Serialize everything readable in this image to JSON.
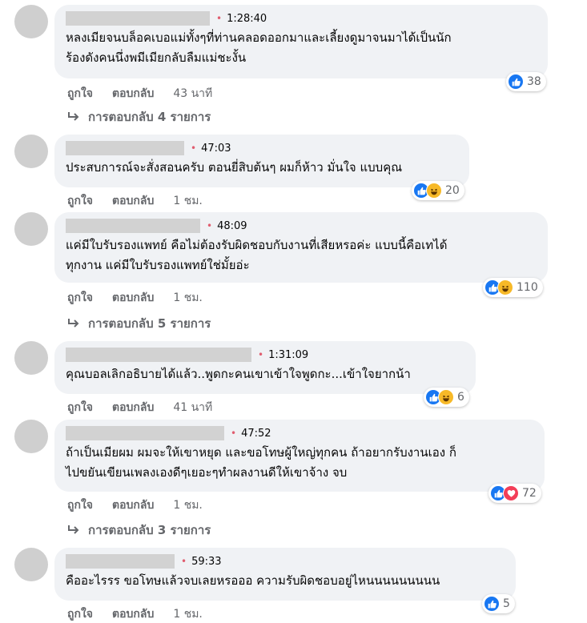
{
  "actions": {
    "like": "ถูกใจ",
    "reply": "ตอบกลับ"
  },
  "comments": [
    {
      "time": "1:28:40",
      "lines": [
        "หลงเมียจนบล็อคเบอแม่ทั้งๆที่ท่านคลอดออกมาและเลี้ยงดูมาจนมาได้เป็นนัก",
        "ร้องดังคนนึ่งพมีเมียกลับลืมแม่ชะงั้น"
      ],
      "ago": "43 นาที",
      "reactions": [
        "like"
      ],
      "count": "38",
      "replies": "การตอบกลับ 4 รายการ"
    },
    {
      "time": "47:03",
      "lines": [
        "ประสบการณ์จะสั่งสอนครับ ตอนยี่สิบต้นๆ ผมก็ห้าว มั่นใจ แบบคุณ"
      ],
      "ago": "1 ชม.",
      "reactions": [
        "like",
        "haha"
      ],
      "count": "20",
      "replies": ""
    },
    {
      "time": "48:09",
      "lines": [
        "แค่มีใบรับรองแพทย์ คือไม่ต้องรับผิดชอบกับงานที่เสียหรอค่ะ แบบนี้คือเทได้",
        "ทุกงาน แค่มีใบรับรองแพทย์ใช่มั้ยอ่ะ"
      ],
      "ago": "1 ชม.",
      "reactions": [
        "like",
        "haha"
      ],
      "count": "110",
      "replies": "การตอบกลับ 5 รายการ"
    },
    {
      "time": "1:31:09",
      "lines": [
        "คุณบอลเลิกอธิบายได้แล้ว..พูดกะคนเขาเข้าใจพูดกะ...เข้าใจยากน้า"
      ],
      "ago": "41 นาที",
      "reactions": [
        "like",
        "haha"
      ],
      "count": "6",
      "replies": ""
    },
    {
      "time": "47:52",
      "lines": [
        "ถ้าเป็นเมียผม ผมจะให้เขาหยุด และขอโทษผู้ใหญ่ทุกคน ถ้าอยากรับงานเอง ก็",
        "ไปขยันเขียนเพลงเองดีๆเยอะๆทำผลงานดีให้เขาจ้าง จบ"
      ],
      "ago": "1 ชม.",
      "reactions": [
        "like",
        "love"
      ],
      "count": "72",
      "replies": "การตอบกลับ 3 รายการ"
    },
    {
      "time": "59:33",
      "lines": [
        "คืออะไรรร ขอโทษแล้วจบเลยหรอออ ความรับผิดชอบอยู่ไหนนนนนนนนน"
      ],
      "ago": "1 ชม.",
      "reactions": [
        "like"
      ],
      "count": "5",
      "replies": ""
    }
  ]
}
